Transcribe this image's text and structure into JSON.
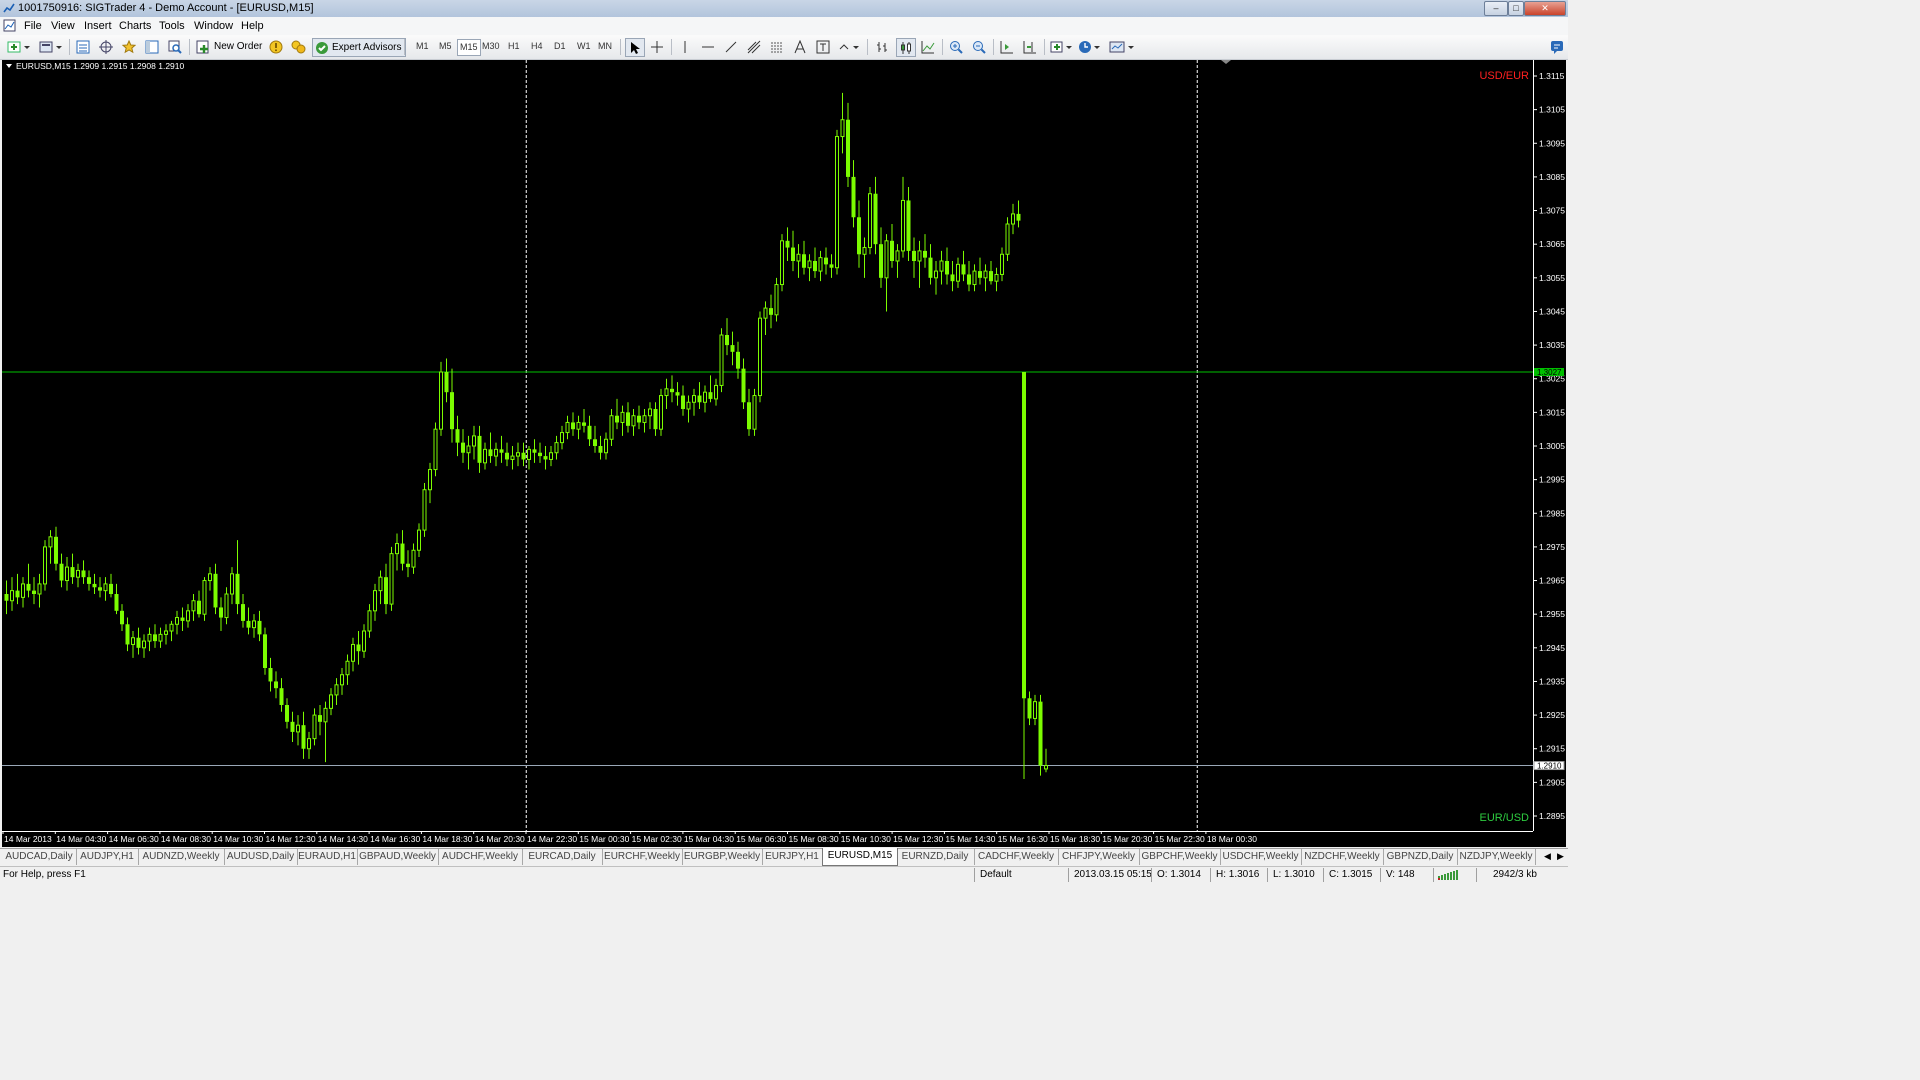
{
  "window": {
    "title": "1001750916: SIGTrader 4 - Demo Account - [EURUSD,M15]"
  },
  "menu": [
    "File",
    "View",
    "Insert",
    "Charts",
    "Tools",
    "Window",
    "Help"
  ],
  "toolbar": {
    "new_order_label": "New Order",
    "expert_advisors_label": "Expert Advisors",
    "timeframes": [
      "M1",
      "M5",
      "M15",
      "M30",
      "H1",
      "H4",
      "D1",
      "W1",
      "MN"
    ],
    "active_timeframe": "M15"
  },
  "chart_data": {
    "type": "candlestick",
    "symbol_header": "EURUSD,M15",
    "ohlc_header": "1.2909 1.2915 1.2908 1.2910",
    "corner_label_top": "USD/EUR",
    "corner_label_bottom": "EUR/USD",
    "colors": {
      "background": "#000000",
      "candle": "#7cfc00",
      "bid_line": "#00c000",
      "grid_dashed": "#ffffff",
      "ask_line": "#9aa8b8",
      "top_label": "#ff2020",
      "bottom_label": "#2ecc40"
    },
    "ylim": [
      1.289,
      1.3119
    ],
    "y_ticks": [
      "1.3115",
      "1.3105",
      "1.3095",
      "1.3085",
      "1.3075",
      "1.3065",
      "1.3055",
      "1.3045",
      "1.3035",
      "1.3025",
      "1.3015",
      "1.3005",
      "1.2995",
      "1.2985",
      "1.2975",
      "1.2965",
      "1.2955",
      "1.2945",
      "1.2935",
      "1.2925",
      "1.2915",
      "1.2905",
      "1.2895"
    ],
    "price_marker_upper": "1.3027",
    "price_marker_lower": "1.2910",
    "x_ticks": [
      "14 Mar 2013",
      "14 Mar 04:30",
      "14 Mar 06:30",
      "14 Mar 08:30",
      "14 Mar 10:30",
      "14 Mar 12:30",
      "14 Mar 14:30",
      "14 Mar 16:30",
      "14 Mar 18:30",
      "14 Mar 20:30",
      "14 Mar 22:30",
      "15 Mar 00:30",
      "15 Mar 02:30",
      "15 Mar 04:30",
      "15 Mar 06:30",
      "15 Mar 08:30",
      "15 Mar 10:30",
      "15 Mar 12:30",
      "15 Mar 14:30",
      "15 Mar 16:30",
      "15 Mar 18:30",
      "15 Mar 20:30",
      "15 Mar 22:30",
      "18 Mar 00:30"
    ],
    "horizontal_levels": {
      "bid": 1.3027,
      "ask": 1.291
    },
    "vertical_separators_index": [
      94.5,
      216.5
    ],
    "candles": [
      [
        1.2961,
        1.2965,
        1.2955,
        1.2959
      ],
      [
        1.2959,
        1.2966,
        1.2956,
        1.2962
      ],
      [
        1.2962,
        1.2967,
        1.2958,
        1.296
      ],
      [
        1.296,
        1.2966,
        1.2957,
        1.2964
      ],
      [
        1.2964,
        1.297,
        1.296,
        1.2962
      ],
      [
        1.2962,
        1.2966,
        1.2958,
        1.2961
      ],
      [
        1.2961,
        1.2967,
        1.2957,
        1.2964
      ],
      [
        1.2964,
        1.2977,
        1.2962,
        1.2975
      ],
      [
        1.2975,
        1.298,
        1.297,
        1.2978
      ],
      [
        1.2978,
        1.2981,
        1.2968,
        1.297
      ],
      [
        1.297,
        1.2973,
        1.2963,
        1.2965
      ],
      [
        1.2965,
        1.2972,
        1.2962,
        1.2969
      ],
      [
        1.2969,
        1.2973,
        1.2964,
        1.2966
      ],
      [
        1.2966,
        1.297,
        1.2963,
        1.2968
      ],
      [
        1.2968,
        1.2971,
        1.2964,
        1.2966
      ],
      [
        1.2966,
        1.2968,
        1.2962,
        1.2964
      ],
      [
        1.2964,
        1.2967,
        1.2961,
        1.2963
      ],
      [
        1.2963,
        1.2966,
        1.296,
        1.2962
      ],
      [
        1.2962,
        1.2966,
        1.2959,
        1.2964
      ],
      [
        1.2964,
        1.2967,
        1.296,
        1.2961
      ],
      [
        1.2961,
        1.2964,
        1.2955,
        1.2956
      ],
      [
        1.2956,
        1.2958,
        1.295,
        1.2952
      ],
      [
        1.2952,
        1.2954,
        1.2944,
        1.2946
      ],
      [
        1.2946,
        1.295,
        1.2942,
        1.2948
      ],
      [
        1.2948,
        1.2951,
        1.2943,
        1.2945
      ],
      [
        1.2945,
        1.2949,
        1.2942,
        1.2947
      ],
      [
        1.2947,
        1.2951,
        1.2944,
        1.2949
      ],
      [
        1.2949,
        1.2952,
        1.2945,
        1.2947
      ],
      [
        1.2947,
        1.2951,
        1.2945,
        1.2949
      ],
      [
        1.2949,
        1.2952,
        1.2946,
        1.295
      ],
      [
        1.295,
        1.2953,
        1.2947,
        1.2952
      ],
      [
        1.2952,
        1.2956,
        1.2949,
        1.2954
      ],
      [
        1.2954,
        1.2957,
        1.295,
        1.2953
      ],
      [
        1.2953,
        1.2958,
        1.2951,
        1.2956
      ],
      [
        1.2956,
        1.2961,
        1.2953,
        1.2959
      ],
      [
        1.2959,
        1.2962,
        1.2954,
        1.2955
      ],
      [
        1.2955,
        1.2966,
        1.2953,
        1.2965
      ],
      [
        1.2965,
        1.2969,
        1.2962,
        1.2967
      ],
      [
        1.2967,
        1.297,
        1.2955,
        1.2957
      ],
      [
        1.2957,
        1.296,
        1.295,
        1.2954
      ],
      [
        1.2954,
        1.2963,
        1.2952,
        1.2961
      ],
      [
        1.2961,
        1.2969,
        1.2958,
        1.2967
      ],
      [
        1.2967,
        1.2977,
        1.2955,
        1.2958
      ],
      [
        1.2958,
        1.2961,
        1.2951,
        1.2953
      ],
      [
        1.2953,
        1.2957,
        1.2949,
        1.2951
      ],
      [
        1.2951,
        1.2955,
        1.2948,
        1.2953
      ],
      [
        1.2953,
        1.2956,
        1.2947,
        1.2949
      ],
      [
        1.2949,
        1.2951,
        1.2937,
        1.2939
      ],
      [
        1.2939,
        1.2942,
        1.2932,
        1.2935
      ],
      [
        1.2935,
        1.2938,
        1.293,
        1.2933
      ],
      [
        1.2933,
        1.2936,
        1.2926,
        1.2928
      ],
      [
        1.2928,
        1.293,
        1.2921,
        1.2923
      ],
      [
        1.2923,
        1.2926,
        1.2917,
        1.292
      ],
      [
        1.292,
        1.2925,
        1.2916,
        1.2922
      ],
      [
        1.2922,
        1.2926,
        1.2912,
        1.2915
      ],
      [
        1.2915,
        1.292,
        1.2912,
        1.2918
      ],
      [
        1.2918,
        1.2927,
        1.2916,
        1.2925
      ],
      [
        1.2925,
        1.2928,
        1.2919,
        1.2923
      ],
      [
        1.2923,
        1.2929,
        1.2911,
        1.2927
      ],
      [
        1.2927,
        1.2933,
        1.2925,
        1.2931
      ],
      [
        1.2931,
        1.2936,
        1.2928,
        1.2934
      ],
      [
        1.2934,
        1.2939,
        1.2931,
        1.2937
      ],
      [
        1.2937,
        1.2943,
        1.2934,
        1.2941
      ],
      [
        1.2941,
        1.2948,
        1.2938,
        1.2946
      ],
      [
        1.2946,
        1.295,
        1.294,
        1.2944
      ],
      [
        1.2944,
        1.2952,
        1.2942,
        1.295
      ],
      [
        1.295,
        1.2958,
        1.2948,
        1.2956
      ],
      [
        1.2956,
        1.2964,
        1.2953,
        1.2962
      ],
      [
        1.2962,
        1.2968,
        1.2958,
        1.2966
      ],
      [
        1.2966,
        1.297,
        1.2955,
        1.2958
      ],
      [
        1.2958,
        1.2975,
        1.2956,
        1.2973
      ],
      [
        1.2973,
        1.2979,
        1.2968,
        1.2976
      ],
      [
        1.2976,
        1.298,
        1.2968,
        1.297
      ],
      [
        1.297,
        1.2974,
        1.2966,
        1.2969
      ],
      [
        1.2969,
        1.2976,
        1.2967,
        1.2974
      ],
      [
        1.2974,
        1.2982,
        1.2972,
        1.298
      ],
      [
        1.298,
        1.2994,
        1.2978,
        1.2992
      ],
      [
        1.2992,
        1.3,
        1.2988,
        1.2998
      ],
      [
        1.2998,
        1.3012,
        1.2996,
        1.301
      ],
      [
        1.301,
        1.303,
        1.3008,
        1.3027
      ],
      [
        1.3027,
        1.3031,
        1.3018,
        1.3021
      ],
      [
        1.3021,
        1.3028,
        1.3006,
        1.301
      ],
      [
        1.301,
        1.3014,
        1.3002,
        1.3006
      ],
      [
        1.3006,
        1.301,
        1.3,
        1.3003
      ],
      [
        1.3003,
        1.3008,
        1.2998,
        1.3005
      ],
      [
        1.3005,
        1.3011,
        1.3001,
        1.3008
      ],
      [
        1.3008,
        1.3011,
        1.2997,
        1.3
      ],
      [
        1.3,
        1.3006,
        1.2998,
        1.3004
      ],
      [
        1.3004,
        1.3009,
        1.3,
        1.3002
      ],
      [
        1.3002,
        1.3006,
        1.2999,
        1.3004
      ],
      [
        1.3004,
        1.3008,
        1.3,
        1.3003
      ],
      [
        1.3003,
        1.3006,
        1.2999,
        1.3001
      ],
      [
        1.3001,
        1.3005,
        1.2998,
        1.3002
      ],
      [
        1.3002,
        1.3006,
        1.2999,
        1.3003
      ],
      [
        1.3003,
        1.3006,
        1.2999,
        1.3001
      ],
      [
        1.3001,
        1.3005,
        1.2998,
        1.3004
      ],
      [
        1.3004,
        1.3007,
        1.3,
        1.3003
      ],
      [
        1.3003,
        1.3006,
        1.3,
        1.3002
      ],
      [
        1.3002,
        1.3005,
        1.2998,
        1.3001
      ],
      [
        1.3001,
        1.3005,
        1.2999,
        1.3003
      ],
      [
        1.3003,
        1.3008,
        1.3001,
        1.3006
      ],
      [
        1.3006,
        1.3011,
        1.3004,
        1.3009
      ],
      [
        1.3009,
        1.3014,
        1.3007,
        1.3012
      ],
      [
        1.3012,
        1.3015,
        1.3008,
        1.301
      ],
      [
        1.301,
        1.3014,
        1.3007,
        1.3012
      ],
      [
        1.3012,
        1.3016,
        1.3009,
        1.3011
      ],
      [
        1.3011,
        1.3014,
        1.3005,
        1.3007
      ],
      [
        1.3007,
        1.3011,
        1.3003,
        1.3005
      ],
      [
        1.3005,
        1.3008,
        1.3001,
        1.3003
      ],
      [
        1.3003,
        1.3009,
        1.3001,
        1.3007
      ],
      [
        1.3007,
        1.3016,
        1.3005,
        1.3014
      ],
      [
        1.3014,
        1.3019,
        1.301,
        1.3012
      ],
      [
        1.3012,
        1.3017,
        1.3008,
        1.3015
      ],
      [
        1.3015,
        1.3018,
        1.3009,
        1.3011
      ],
      [
        1.3011,
        1.3016,
        1.3008,
        1.3014
      ],
      [
        1.3014,
        1.3017,
        1.301,
        1.3012
      ],
      [
        1.3012,
        1.3016,
        1.3009,
        1.3014
      ],
      [
        1.3014,
        1.3018,
        1.301,
        1.3016
      ],
      [
        1.3016,
        1.3018,
        1.3008,
        1.301
      ],
      [
        1.301,
        1.3022,
        1.3008,
        1.302
      ],
      [
        1.302,
        1.3025,
        1.3016,
        1.3022
      ],
      [
        1.3022,
        1.3026,
        1.3018,
        1.3021
      ],
      [
        1.3021,
        1.3024,
        1.3017,
        1.302
      ],
      [
        1.302,
        1.3023,
        1.3014,
        1.3016
      ],
      [
        1.3016,
        1.302,
        1.3012,
        1.3018
      ],
      [
        1.3018,
        1.3022,
        1.3014,
        1.302
      ],
      [
        1.302,
        1.3024,
        1.3016,
        1.3018
      ],
      [
        1.3018,
        1.3023,
        1.3015,
        1.3021
      ],
      [
        1.3021,
        1.3026,
        1.3018,
        1.3019
      ],
      [
        1.3019,
        1.3025,
        1.3017,
        1.3023
      ],
      [
        1.3023,
        1.304,
        1.3021,
        1.3038
      ],
      [
        1.3038,
        1.3043,
        1.3032,
        1.3035
      ],
      [
        1.3035,
        1.3039,
        1.3029,
        1.3033
      ],
      [
        1.3033,
        1.3036,
        1.3025,
        1.3028
      ],
      [
        1.3028,
        1.3031,
        1.3016,
        1.3018
      ],
      [
        1.3018,
        1.3022,
        1.3008,
        1.301
      ],
      [
        1.301,
        1.3022,
        1.3008,
        1.302
      ],
      [
        1.302,
        1.3045,
        1.3018,
        1.3043
      ],
      [
        1.3043,
        1.3048,
        1.3038,
        1.3046
      ],
      [
        1.3046,
        1.305,
        1.304,
        1.3044
      ],
      [
        1.3044,
        1.3055,
        1.3042,
        1.3053
      ],
      [
        1.3053,
        1.3068,
        1.3051,
        1.3066
      ],
      [
        1.3066,
        1.307,
        1.306,
        1.3064
      ],
      [
        1.3064,
        1.3069,
        1.3057,
        1.306
      ],
      [
        1.306,
        1.3065,
        1.3055,
        1.3062
      ],
      [
        1.3062,
        1.3066,
        1.3056,
        1.3058
      ],
      [
        1.3058,
        1.3062,
        1.3054,
        1.306
      ],
      [
        1.306,
        1.3064,
        1.3055,
        1.3057
      ],
      [
        1.3057,
        1.3063,
        1.3054,
        1.3061
      ],
      [
        1.3061,
        1.3064,
        1.3056,
        1.3059
      ],
      [
        1.3059,
        1.3062,
        1.3055,
        1.3058
      ],
      [
        1.3058,
        1.3099,
        1.3056,
        1.3097
      ],
      [
        1.3097,
        1.311,
        1.3092,
        1.3102
      ],
      [
        1.3102,
        1.3107,
        1.3082,
        1.3085
      ],
      [
        1.3085,
        1.309,
        1.307,
        1.3073
      ],
      [
        1.3073,
        1.3078,
        1.3058,
        1.3062
      ],
      [
        1.3062,
        1.3067,
        1.3055,
        1.3064
      ],
      [
        1.3064,
        1.3082,
        1.3062,
        1.308
      ],
      [
        1.308,
        1.3085,
        1.3062,
        1.3065
      ],
      [
        1.3065,
        1.307,
        1.3052,
        1.3055
      ],
      [
        1.3055,
        1.3068,
        1.3045,
        1.3066
      ],
      [
        1.3066,
        1.3071,
        1.3058,
        1.306
      ],
      [
        1.306,
        1.3065,
        1.3055,
        1.3063
      ],
      [
        1.3063,
        1.3085,
        1.3061,
        1.3078
      ],
      [
        1.3078,
        1.3082,
        1.306,
        1.3063
      ],
      [
        1.3063,
        1.3067,
        1.3055,
        1.306
      ],
      [
        1.306,
        1.3066,
        1.3052,
        1.3063
      ],
      [
        1.3063,
        1.3068,
        1.3058,
        1.3061
      ],
      [
        1.3061,
        1.3065,
        1.3053,
        1.3055
      ],
      [
        1.3055,
        1.306,
        1.305,
        1.3057
      ],
      [
        1.3057,
        1.3063,
        1.3053,
        1.306
      ],
      [
        1.306,
        1.3064,
        1.3053,
        1.3056
      ],
      [
        1.3056,
        1.306,
        1.3051,
        1.3054
      ],
      [
        1.3054,
        1.3061,
        1.3052,
        1.3059
      ],
      [
        1.3059,
        1.3063,
        1.3054,
        1.3056
      ],
      [
        1.3056,
        1.306,
        1.3051,
        1.3053
      ],
      [
        1.3053,
        1.3059,
        1.3051,
        1.3057
      ],
      [
        1.3057,
        1.3061,
        1.3053,
        1.3055
      ],
      [
        1.3055,
        1.3059,
        1.3051,
        1.3057
      ],
      [
        1.3057,
        1.306,
        1.3053,
        1.3054
      ],
      [
        1.3054,
        1.3058,
        1.3051,
        1.3056
      ],
      [
        1.3056,
        1.3064,
        1.3054,
        1.3062
      ],
      [
        1.3062,
        1.3073,
        1.306,
        1.3071
      ],
      [
        1.3071,
        1.3077,
        1.3068,
        1.3074
      ],
      [
        1.3074,
        1.3078,
        1.307,
        1.3072
      ],
      [
        1.3027,
        1.3027,
        1.2906,
        1.293
      ],
      [
        1.293,
        1.2932,
        1.2922,
        1.2924
      ],
      [
        1.2924,
        1.2931,
        1.2922,
        1.2929
      ],
      [
        1.2929,
        1.2931,
        1.2907,
        1.291
      ],
      [
        1.2909,
        1.2915,
        1.2908,
        1.291
      ]
    ]
  },
  "symbol_tabs": [
    "AUDCAD,Daily",
    "AUDJPY,H1",
    "AUDNZD,Weekly",
    "AUDUSD,Daily",
    "EURAUD,H1",
    "GBPAUD,Weekly",
    "AUDCHF,Weekly",
    "EURCAD,Daily",
    "EURCHF,Weekly",
    "EURGBP,Weekly",
    "EURJPY,H1",
    "EURUSD,M15",
    "EURNZD,Daily",
    "CADCHF,Weekly",
    "CHFJPY,Weekly",
    "GBPCHF,Weekly",
    "USDCHF,Weekly",
    "NZDCHF,Weekly",
    "GBPNZD,Daily",
    "NZDJPY,Weekly"
  ],
  "active_tab": "EURUSD,M15",
  "status": {
    "help": "For Help, press F1",
    "profile": "Default",
    "time": "2013.03.15 05:15",
    "open": "O: 1.3014",
    "high": "H: 1.3016",
    "low": "L: 1.3010",
    "close": "C: 1.3015",
    "volume": "V: 148",
    "traffic": "2942/3 kb"
  }
}
